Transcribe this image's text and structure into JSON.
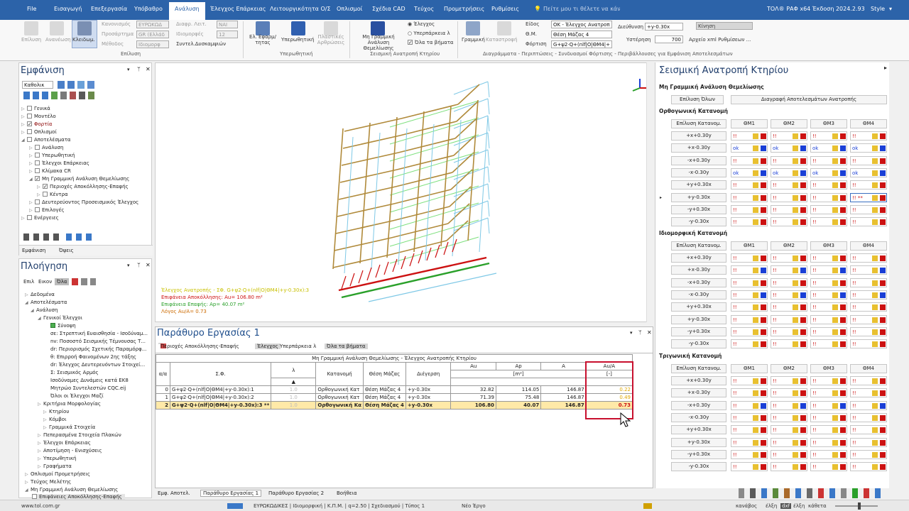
{
  "menu": {
    "items": [
      "File",
      "Εισαγωγή",
      "Επεξεργασία",
      "Υπόβαθρο",
      "Ανάλυση",
      "Έλεγχος Επάρκειας",
      "Λειτουργικότητα Ο/Σ",
      "Οπλισμοί",
      "Σχέδια CAD",
      "Τεύχος",
      "Προμετρήσεις",
      "Ρυθμίσεις"
    ],
    "active_index": 4,
    "search_placeholder": "Πείτε μου τι θέλετε να κάνετε",
    "app_title": "ΤΟΛ® ΡΑΦ x64 Έκδοση 2024.2.93",
    "style_label": "Style"
  },
  "ribbon": {
    "selection": {
      "b1": "Επίλυση",
      "b2": "Ανανέωση",
      "b3": "Κλειδωμ.",
      "l_reg": "Κανονισμός",
      "v_reg": "ΕΥΡΩΚΩΔ",
      "l_pros": "Προσάρτημα",
      "v_pros": "GR (Ελλάδ",
      "l_meth": "Μέθοδος",
      "v_meth": "Ιδιομορφ",
      "l_dyn": "Διαφρ. Λειτ.",
      "v_dyn": "ΝΑΙ",
      "l_modes": "Ιδιομορφές",
      "v_modes": "12",
      "group": "Επίλυση",
      "b4": "Συντελ.Δυσκαμψιών"
    },
    "pushover": {
      "b1": "Ελ. Εφαρμ/τητας",
      "b2": "Υπερωθητική",
      "b3": "Πλαστικές Αρθρώσεις",
      "group": "Υπερωθητική"
    },
    "nonlinear": {
      "b1": "Μη Γραμμική Ανάλυση Θεμελίωσης",
      "r1": "Έλεγχος",
      "r2": "Υπερπάρκεια λ",
      "r3": "Όλα τα βήματα",
      "group": "Σεισμική Ανατροπή Κτηρίου"
    },
    "diagrams": {
      "b1": "Γραμμική",
      "b2": "Καταστροφή",
      "l_type": "Είδος",
      "v_type": "ΟΚ - Έλεγχος Ανατροπ",
      "l_tm": "Θ.Μ.",
      "v_tm": "Θέση Μάζας 4",
      "l_load": "Φόρτιση",
      "v_load": "G+ψ2·Q+(nlf|Ο|ΘΜ4|+",
      "l_dir": "Διεύθυνση",
      "v_dir": "+y-0.30x",
      "l_hyst": "Υστέρηση",
      "v_hyst": "700",
      "move": "Κίνηση",
      "xml": "Αρχείο xml Ρυθμίσεων ...",
      "group": "Διαγράμματα - Περιπτώσεις - Συνδυασμοί Φόρτισης - Περιβάλλουσες για Εμφάνιση Αποτελεσμάτων"
    }
  },
  "display_panel": {
    "title": "Εμφάνιση",
    "filter": "Καθολικ",
    "tree": [
      "Γενικά",
      "Μοντέλο",
      "Φορτία",
      "Οπλισμοί",
      "Αποτελέσματα",
      "Ανάλυση",
      "Υπερωθητική",
      "Έλεγχοι Επάρκειας",
      "Κλίμακα CR",
      "Μη Γραμμική Ανάλυση Θεμελίωσης",
      "Περιοχές Αποκόλλησης-Επαφής",
      "Κέντρα",
      "Δευτερεύοντος Προσεισμικός Έλεγχος",
      "Επιλογές",
      "Ενέργειες"
    ],
    "tab1": "Εμφάνιση",
    "tab2": "Όψεις"
  },
  "nav_panel": {
    "title": "Πλοήγηση",
    "filters": [
      "Επιλ",
      "Εικον",
      "Όλα"
    ],
    "tree": [
      "Δεδομένα",
      "Αποτελέσματα",
      "Ανάλυση",
      "Γενικοί Έλεγχοι",
      "Σύνοψη",
      "σε: Στρεπτική Ευαισθησία - Ισοδύναμ...",
      "nv: Ποσοστό Σεισμικής Τέμνουσας Τ...",
      "dr: Περιορισμός Σχετικής Παραμόρφ...",
      "θ: Επιρροή Φαινομένων 2ης τάξης",
      "dr: Έλεγχος Δευτερευόντων Στοιχεί...",
      "Σ: Σεισμικός Αρμός",
      "Ισοδύναμες Δυνάμεις κατά ΕΚ8",
      "Μητρώο Συντελεστών CQC.eij",
      "Όλοι οι Έλεγχοι Μαζί",
      "Κριτήρια Μορφολογίας",
      "Κτηρίου",
      "Κόμβοι",
      "Γραμμικά Στοιχεία",
      "Πεπερασμένα Στοιχεία Πλακών",
      "Έλεγχοι Επάρκειας",
      "Αποτίμηση - Ενισχύσεις",
      "Υπερωθητική",
      "Γραφήματα",
      "Οπλισμοί Προμετρήσεις",
      "Τεύχος Μελέτης",
      "Μη Γραμμική Ανάλυση Θεμελίωσης",
      "Επιφάνειες Αποκόλλησης-Επαφής"
    ]
  },
  "viewport": {
    "legend1": "Έλεγχος Ανατροπής - ΣΦ.  G+ψ2·Q+(nlf|Ο|ΘΜ4|+y-0.30x):3",
    "legend2": "Επιφάνεια Αποκόλλησης: Au= 106.80 m²",
    "legend3": "Επιφάνεια Επαφής: Ap= 40.07 m²",
    "legend4": "Λόγος Au/A= 0.73"
  },
  "work": {
    "title": "Παράθυρο Εργασίας 1",
    "tabs": [
      "Περιοχές Αποκόλλησης-Επαφής",
      "Έλεγχος",
      "Υπερπάρκεια λ",
      "Όλα τα βήματα"
    ],
    "table_title": "Μη Γραμμική Ανάλυση Θεμελίωσης - Έλεγχος Ανατροπής Κτηρίου",
    "headers": [
      "α/α",
      "Σ.Φ.",
      "λ",
      "Κατανομή",
      "Θέση Μάζας",
      "Διέγερση",
      "Au",
      "Ap",
      "A",
      "Au/A"
    ],
    "units": [
      "[m²]",
      "[-]"
    ],
    "rows": [
      [
        "0",
        "G+ψ2·Q+(nlf|Ο|ΘΜ4|+y-0.30x):1",
        "1.0",
        "Ορθογωνική Κατ",
        "Θέση Μάζας 4",
        "+y-0.30x",
        "32.82",
        "114.05",
        "146.87",
        "0.22"
      ],
      [
        "1",
        "G+ψ2·Q+(nlf|Ο|ΘΜ4|+y-0.30x):2",
        "1.0",
        "Ορθογωνική Κατ",
        "Θέση Μάζας 4",
        "+y-0.30x",
        "71.39",
        "75.48",
        "146.87",
        "0.49"
      ],
      [
        "2",
        "G+ψ2·Q+(nlf|Ο|ΘΜ4|+y-0.30x):3 **",
        "1.0",
        "Ορθογωνική Κα",
        "Θέση Μάζας 4",
        "+y-0.30x",
        "106.80",
        "40.07",
        "146.87",
        "0.73"
      ]
    ],
    "bottom_tabs": [
      "Εμφ. Αποτελ.",
      "Παράθυρο Εργασίας 1",
      "Παράθυρο Εργασίας 2",
      "Βοήθεια"
    ]
  },
  "right_panel": {
    "title": "Σεισμική Ανατροπή Κτηρίου",
    "section": "Μη Γραμμική Ανάλυση Θεμελίωσης",
    "solve_all": "Επίλυση Όλων",
    "delete": "Διαγραφή Αποτελεσμάτων Ανατροπής",
    "solve_dist": "Επίλυση Κατανομ.",
    "columns": [
      "ΘΜ1",
      "ΘΜ2",
      "ΘΜ3",
      "ΘΜ4"
    ],
    "dirs": [
      "+x+0.30y",
      "+x-0.30y",
      "-x+0.30y",
      "-x-0.30y",
      "+y+0.30x",
      "+y-0.30x",
      "-y+0.30x",
      "-y-0.30x"
    ],
    "groups": [
      {
        "name": "Ορθογωνική Κατανομή",
        "rows": [
          [
            "!!",
            "y",
            "r",
            "!!",
            "y",
            "r",
            "!!",
            "y",
            "r",
            "!!",
            "y",
            "r"
          ],
          [
            "ok",
            "y",
            "b",
            "ok",
            "y",
            "b",
            "ok",
            "y",
            "b",
            "ok",
            "y",
            "b"
          ],
          [
            "!!",
            "y",
            "r",
            "!!",
            "y",
            "r",
            "!!",
            "y",
            "r",
            "!!",
            "y",
            "r"
          ],
          [
            "ok",
            "y",
            "b",
            "ok",
            "y",
            "b",
            "ok",
            "y",
            "b",
            "ok",
            "y",
            "b"
          ],
          [
            "!!",
            "y",
            "r",
            "!!",
            "y",
            "r",
            "!!",
            "y",
            "r",
            "!!",
            "y",
            "r"
          ],
          [
            "!!",
            "y",
            "r",
            "!!",
            "y",
            "r",
            "!!",
            "y",
            "r",
            "!! **",
            "y",
            "r"
          ],
          [
            "!!",
            "y",
            "r",
            "!!",
            "y",
            "r",
            "!!",
            "y",
            "r",
            "!!",
            "y",
            "r"
          ],
          [
            "!!",
            "y",
            "r",
            "!!",
            "y",
            "r",
            "!!",
            "y",
            "r",
            "!!",
            "y",
            "r"
          ]
        ]
      },
      {
        "name": "Ιδιομορφική Κατανομή",
        "rows": [
          [
            "!!",
            "y",
            "r",
            "!!",
            "y",
            "r",
            "!!",
            "y",
            "r",
            "!!",
            "y",
            "r"
          ],
          [
            "!!",
            "y",
            "b",
            "!!",
            "y",
            "b",
            "!!",
            "y",
            "b",
            "!!",
            "y",
            "b"
          ],
          [
            "!!",
            "y",
            "r",
            "!!",
            "y",
            "r",
            "!!",
            "y",
            "r",
            "!!",
            "y",
            "r"
          ],
          [
            "!!",
            "y",
            "b",
            "!!",
            "y",
            "b",
            "!!",
            "y",
            "b",
            "!!",
            "y",
            "b"
          ],
          [
            "!!",
            "y",
            "r",
            "!!",
            "y",
            "r",
            "!!",
            "y",
            "r",
            "!!",
            "y",
            "r"
          ],
          [
            "!!",
            "y",
            "r",
            "!!",
            "y",
            "r",
            "!!",
            "y",
            "r",
            "!!",
            "y",
            "r"
          ],
          [
            "!!",
            "y",
            "r",
            "!!",
            "y",
            "r",
            "!!",
            "y",
            "r",
            "!!",
            "y",
            "r"
          ],
          [
            "!!",
            "y",
            "r",
            "!!",
            "y",
            "r",
            "!!",
            "y",
            "r",
            "!!",
            "y",
            "r"
          ]
        ]
      },
      {
        "name": "Τριγωνική Κατανομή",
        "rows": [
          [
            "!!",
            "y",
            "r",
            "!!",
            "y",
            "r",
            "!!",
            "y",
            "r",
            "!!",
            "y",
            "r"
          ],
          [
            "!!",
            "y",
            "r",
            "!!",
            "y",
            "r",
            "!!",
            "y",
            "r",
            "!!",
            "y",
            "r"
          ],
          [
            "!!",
            "y",
            "b",
            "!!",
            "y",
            "b",
            "!!",
            "y",
            "b",
            "!!",
            "y",
            "b"
          ],
          [
            "!!",
            "y",
            "r",
            "!!",
            "y",
            "r",
            "!!",
            "y",
            "r",
            "!!",
            "y",
            "r"
          ],
          [
            "!!",
            "y",
            "r",
            "!!",
            "y",
            "r",
            "!!",
            "y",
            "r",
            "!!",
            "y",
            "r"
          ],
          [
            "!!",
            "y",
            "r",
            "!!",
            "y",
            "r",
            "!!",
            "y",
            "r",
            "!!",
            "y",
            "r"
          ],
          [
            "!!",
            "y",
            "r",
            "!!",
            "y",
            "r",
            "!!",
            "y",
            "r",
            "!!",
            "y",
            "r"
          ],
          [
            "!!",
            "y",
            "r",
            "!!",
            "y",
            "r",
            "!!",
            "y",
            "r",
            "!!",
            "y",
            "r"
          ]
        ]
      }
    ]
  },
  "status": {
    "site": "www.tol.com.gr",
    "info": "ΕΥΡΩΚΩΔΙΚΕΣ | Ιδιομορφική | Κ.Π.Μ. | q=2.50 | Σχεδιασμού | Τύπος 1",
    "project": "Νέο Έργο",
    "k1": "κανάβος",
    "k2": "έλξη",
    "k3": "dxf",
    "k4": "έλξη",
    "k5": "κάθετα"
  },
  "colors": {
    "menubar": "#2c63a9",
    "highlight_row": "#ffe9a8",
    "red_frame": "#c8102e",
    "ok_blue": "#1a3fd6",
    "warn_red": "#cc1111",
    "yellow": "#e8c030"
  }
}
